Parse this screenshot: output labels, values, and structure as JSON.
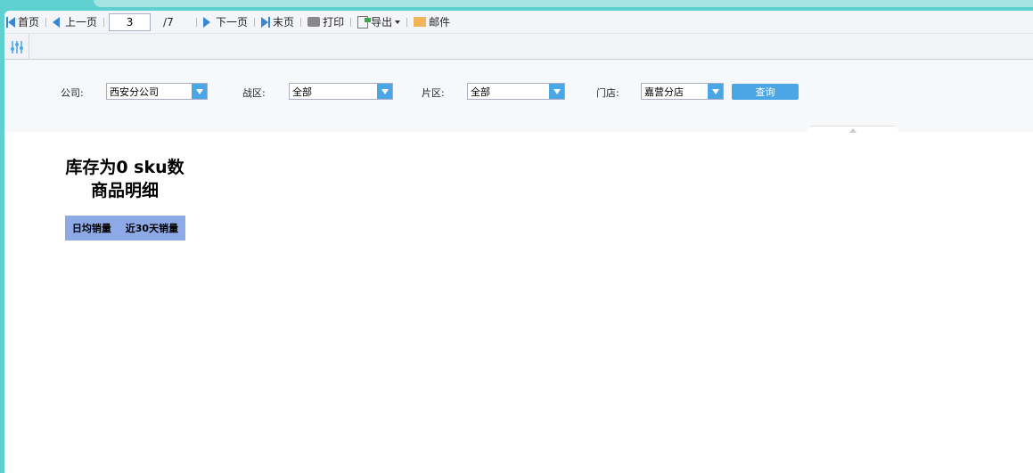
{
  "toolbar": {
    "first": "首页",
    "prev": "上一页",
    "page": "3",
    "total": "/7",
    "next": "下一页",
    "last": "末页",
    "print": "打印",
    "export": "导出",
    "mail": "邮件"
  },
  "params": {
    "company": {
      "label": "公司:",
      "value": "西安分公司"
    },
    "war_zone": {
      "label": "战区:",
      "value": "全部"
    },
    "area": {
      "label": "片区:",
      "value": "全部"
    },
    "store": {
      "label": "门店:",
      "value": "嘉营分店"
    },
    "query": "查询"
  },
  "report": {
    "title_line1": "库存为0 sku数",
    "title_line2": "商品明细",
    "columns": [
      "日均销量",
      "近30天销量"
    ]
  }
}
